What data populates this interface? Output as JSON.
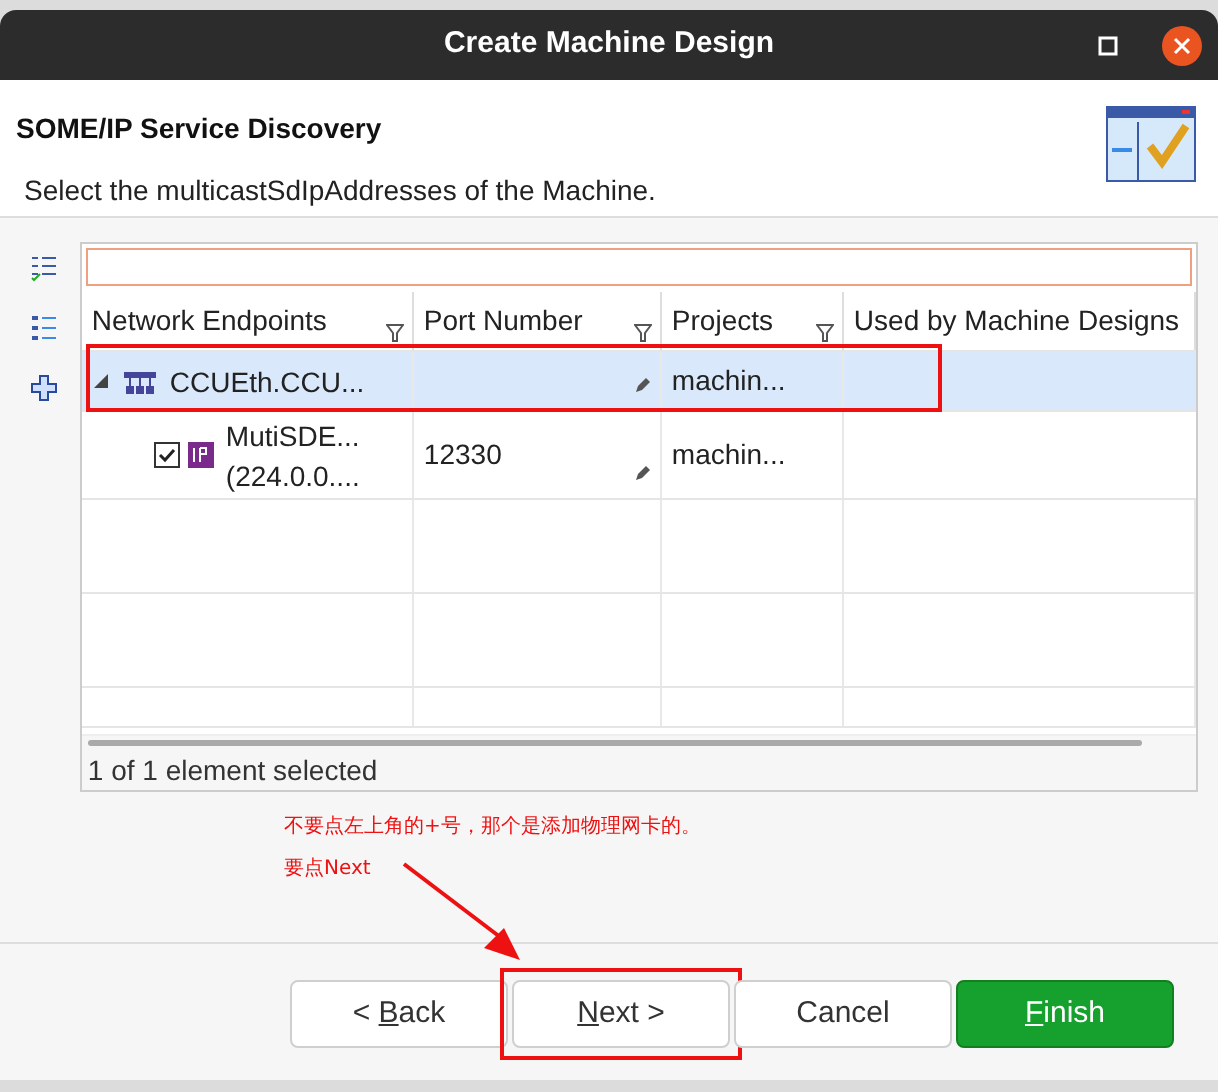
{
  "window": {
    "title": "Create Machine Design"
  },
  "header": {
    "title": "SOME/IP Service Discovery",
    "description": "Select the multicastSdIpAddresses of the Machine."
  },
  "table": {
    "columns": [
      {
        "label": "Network Endpoints",
        "filter": true
      },
      {
        "label": "Port Number",
        "filter": true
      },
      {
        "label": "Projects",
        "filter": true
      },
      {
        "label": "Used by Machine Designs",
        "filter": false
      }
    ],
    "rows": [
      {
        "kind": "group",
        "label_lines": [
          "CCUEth.CCU..."
        ],
        "port": "",
        "project": "machin...",
        "selected": true,
        "expanded": true,
        "highlighted": true
      },
      {
        "kind": "item",
        "label_lines": [
          "MutiSDE...",
          "(224.0.0...."
        ],
        "port": "12330",
        "project": "machin...",
        "selected": false,
        "checked": true,
        "highlighted": false
      }
    ]
  },
  "status": "1 of 1 element selected",
  "annotation": {
    "lines": [
      "不要点左上角的+号，那个是添加物理网卡的。",
      "要点Next"
    ]
  },
  "buttons": [
    {
      "kind": "normal",
      "pre": "< ",
      "key": "B",
      "post": "ack",
      "highlighted": false
    },
    {
      "kind": "normal",
      "key": "N",
      "post": "ext >",
      "highlighted": true
    },
    {
      "kind": "normal",
      "post": "Cancel",
      "highlighted": false
    },
    {
      "kind": "primary",
      "key": "F",
      "post": "inish",
      "highlighted": false
    }
  ]
}
